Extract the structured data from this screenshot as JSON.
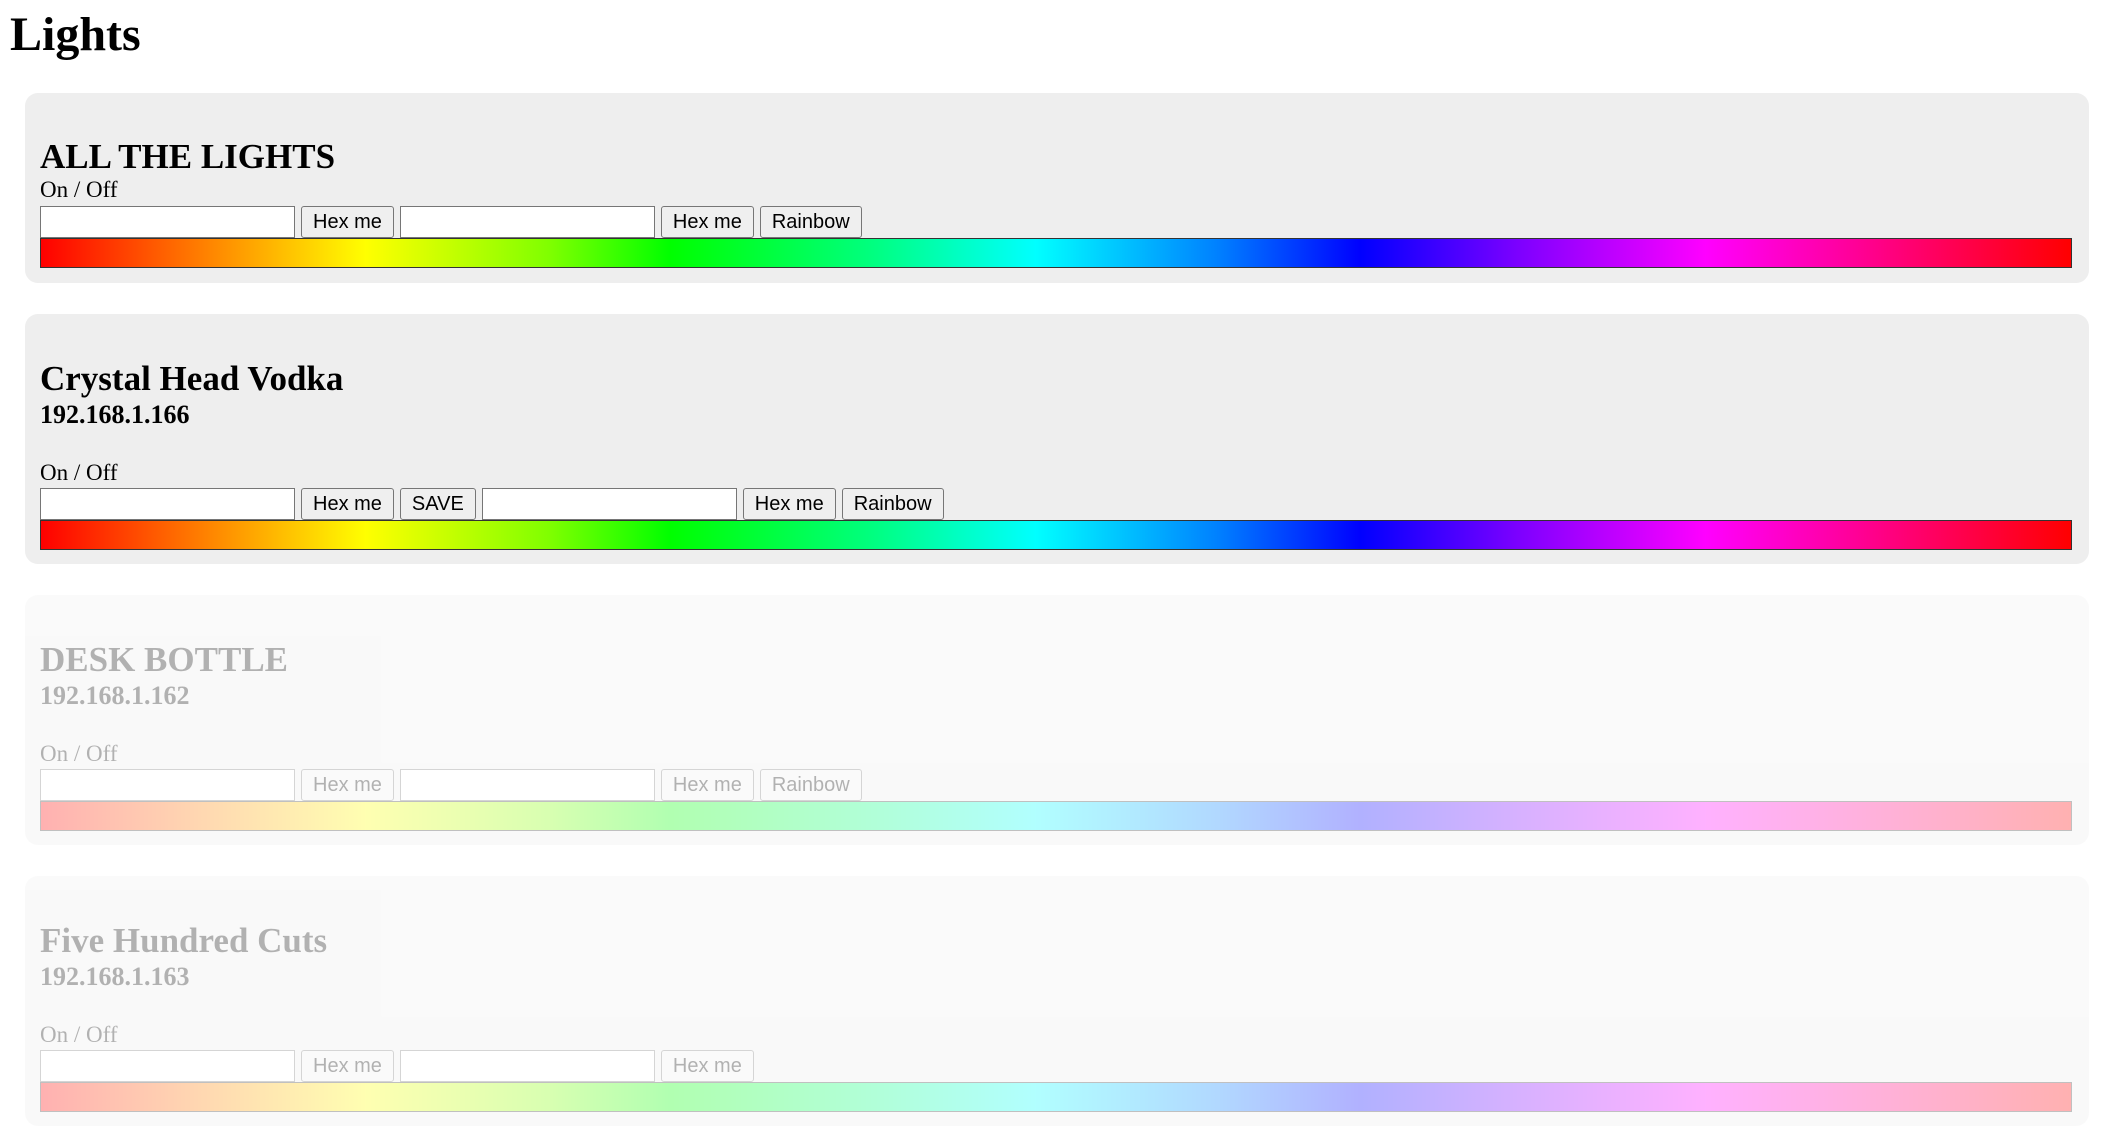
{
  "page": {
    "title": "Lights"
  },
  "ui": {
    "on_off": "On / Off",
    "hex_label": "Hex me",
    "save_label": "SAVE",
    "rainbow_label": "Rainbow"
  },
  "lights": [
    {
      "name": "ALL THE LIGHTS",
      "ip": "",
      "enabled": true
    },
    {
      "name": "Crystal Head Vodka",
      "ip": "192.168.1.166",
      "enabled": true
    },
    {
      "name": "DESK BOTTLE",
      "ip": "192.168.1.162",
      "enabled": false
    },
    {
      "name": "Five Hundred Cuts",
      "ip": "192.168.1.163",
      "enabled": false
    }
  ]
}
